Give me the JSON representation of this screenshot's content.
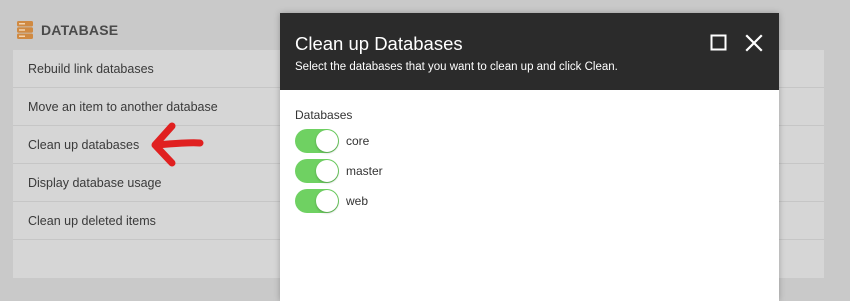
{
  "section": {
    "icon": "database-icon",
    "title": "DATABASE",
    "items": [
      {
        "label": "Rebuild link databases"
      },
      {
        "label": "Move an item to another database"
      },
      {
        "label": "Clean up databases"
      },
      {
        "label": "Display database usage"
      },
      {
        "label": "Clean up deleted items"
      }
    ]
  },
  "annotation": {
    "icon": "red-arrow-icon",
    "color": "#e02020"
  },
  "dialog": {
    "title": "Clean up Databases",
    "subtitle": "Select the databases that you want to clean up and click Clean.",
    "maximize_icon": "maximize-icon",
    "close_icon": "close-icon",
    "group_label": "Databases",
    "databases": [
      {
        "label": "core",
        "enabled": true
      },
      {
        "label": "master",
        "enabled": true
      },
      {
        "label": "web",
        "enabled": true
      }
    ],
    "toggle_color": "#6fd162"
  }
}
